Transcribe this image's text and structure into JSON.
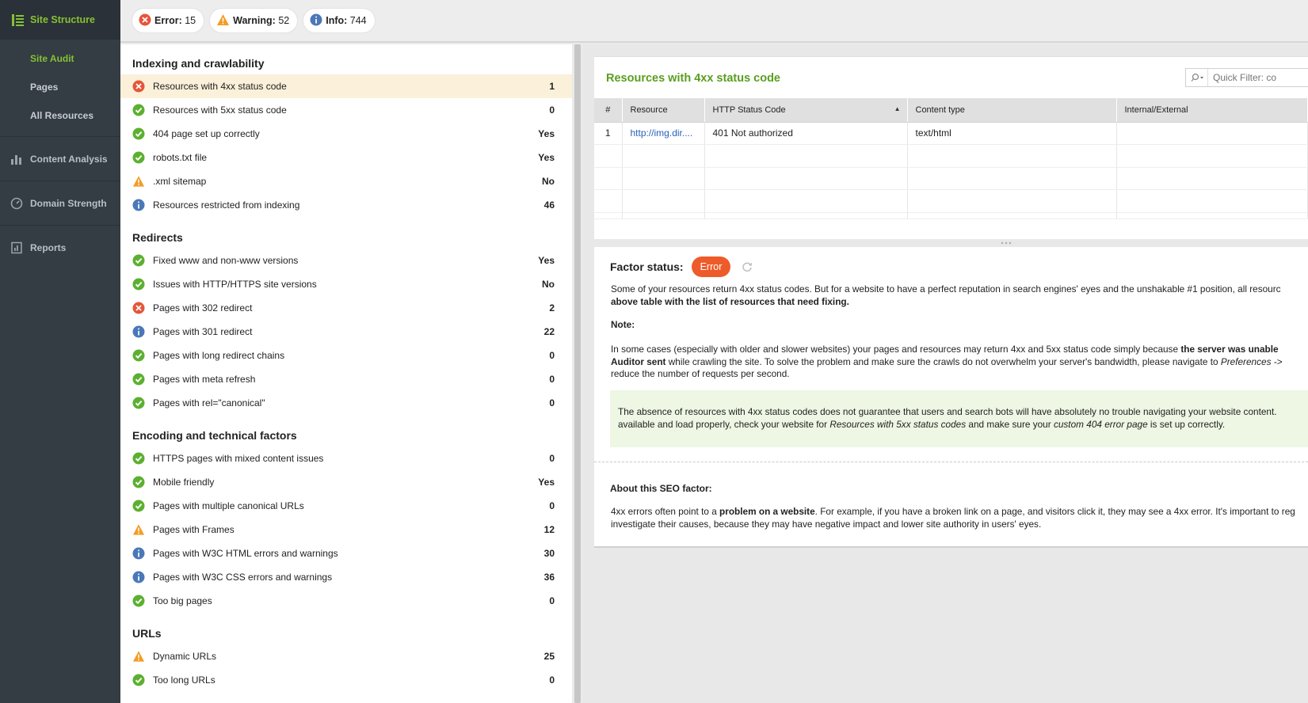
{
  "sidebar": {
    "top_label": "Site Structure",
    "sub_items": [
      "Site Audit",
      "Pages",
      "All Resources"
    ],
    "sections": [
      "Content Analysis",
      "Domain Strength",
      "Reports"
    ]
  },
  "summary": {
    "error_label": "Error:",
    "error_count": "15",
    "warning_label": "Warning:",
    "warning_count": "52",
    "info_label": "Info:",
    "info_count": "744"
  },
  "factor_sections": [
    {
      "title": "Indexing and crawlability",
      "items": [
        {
          "status": "error",
          "label": "Resources with 4xx status code",
          "value": "1",
          "selected": true
        },
        {
          "status": "ok",
          "label": "Resources with 5xx status code",
          "value": "0"
        },
        {
          "status": "ok",
          "label": "404 page set up correctly",
          "value": "Yes"
        },
        {
          "status": "ok",
          "label": "robots.txt file",
          "value": "Yes"
        },
        {
          "status": "warning",
          "label": ".xml sitemap",
          "value": "No"
        },
        {
          "status": "info",
          "label": "Resources restricted from indexing",
          "value": "46"
        }
      ]
    },
    {
      "title": "Redirects",
      "items": [
        {
          "status": "ok",
          "label": "Fixed www and non-www versions",
          "value": "Yes"
        },
        {
          "status": "ok",
          "label": "Issues with HTTP/HTTPS site versions",
          "value": "No"
        },
        {
          "status": "error",
          "label": "Pages with 302 redirect",
          "value": "2"
        },
        {
          "status": "info",
          "label": "Pages with 301 redirect",
          "value": "22"
        },
        {
          "status": "ok",
          "label": "Pages with long redirect chains",
          "value": "0"
        },
        {
          "status": "ok",
          "label": "Pages with meta refresh",
          "value": "0"
        },
        {
          "status": "ok",
          "label": "Pages with rel=\"canonical\"",
          "value": "0"
        }
      ]
    },
    {
      "title": "Encoding and technical factors",
      "items": [
        {
          "status": "ok",
          "label": "HTTPS pages with mixed content issues",
          "value": "0"
        },
        {
          "status": "ok",
          "label": "Mobile friendly",
          "value": "Yes"
        },
        {
          "status": "ok",
          "label": "Pages with multiple canonical URLs",
          "value": "0"
        },
        {
          "status": "warning",
          "label": "Pages with Frames",
          "value": "12"
        },
        {
          "status": "info",
          "label": "Pages with W3C HTML errors and warnings",
          "value": "30"
        },
        {
          "status": "info",
          "label": "Pages with W3C CSS errors and warnings",
          "value": "36"
        },
        {
          "status": "ok",
          "label": "Too big pages",
          "value": "0"
        }
      ]
    },
    {
      "title": "URLs",
      "items": [
        {
          "status": "warning",
          "label": "Dynamic URLs",
          "value": "25"
        },
        {
          "status": "ok",
          "label": "Too long URLs",
          "value": "0"
        }
      ]
    }
  ],
  "detail": {
    "title": "Resources with 4xx status code",
    "quick_filter_placeholder": "Quick Filter: co",
    "columns": [
      "#",
      "Resource",
      "HTTP Status Code",
      "Content type",
      "Internal/External"
    ],
    "rows": [
      [
        "1",
        "http://img.dir....",
        "401 Not authorized",
        "text/html",
        ""
      ]
    ],
    "factor_status_label": "Factor status:",
    "factor_status_value": "Error",
    "desc_line1": "Some of your resources return 4xx status codes. But for a website to have a perfect reputation in search engines' eyes and the unshakable #1 position, all resourc",
    "desc_line2": "above table with the list of resources that need fixing.",
    "note_title": "Note:",
    "note_line1_a": "In some cases (especially with older and slower websites) your pages and resources may return 4xx and 5xx status code simply because ",
    "note_line1_b": "the server was unable",
    "note_line2_a": "Auditor sent",
    "note_line2_b": " while crawling the site. To solve the problem and make sure the crawls do not overwhelm your server's bandwidth, please navigate to ",
    "note_line2_c": "Preferences ->",
    "note_line3": "reduce the number of requests per second.",
    "green_line1": "The absence of resources with 4xx status codes does not guarantee that users and search bots will have absolutely no trouble navigating your website content.",
    "green_line2_a": "available and load properly, check your website for ",
    "green_line2_b": "Resources with 5xx status codes",
    "green_line2_c": " and make sure your ",
    "green_line2_d": "custom 404 error page",
    "green_line2_e": " is set up correctly.",
    "about_title": "About this SEO factor:",
    "about_line1_a": "4xx errors often point to a ",
    "about_line1_b": "problem on a website",
    "about_line1_c": ". For example, if you have a broken link on a page, and visitors click it, they may see a 4xx error. It's important to reg",
    "about_line2": "investigate their causes, because they may have negative impact and lower site authority in users' eyes."
  },
  "colors": {
    "accent_green": "#86c232",
    "error": "#e5553a",
    "warning": "#f39c24",
    "info": "#4a78b8",
    "ok": "#5cb030"
  }
}
